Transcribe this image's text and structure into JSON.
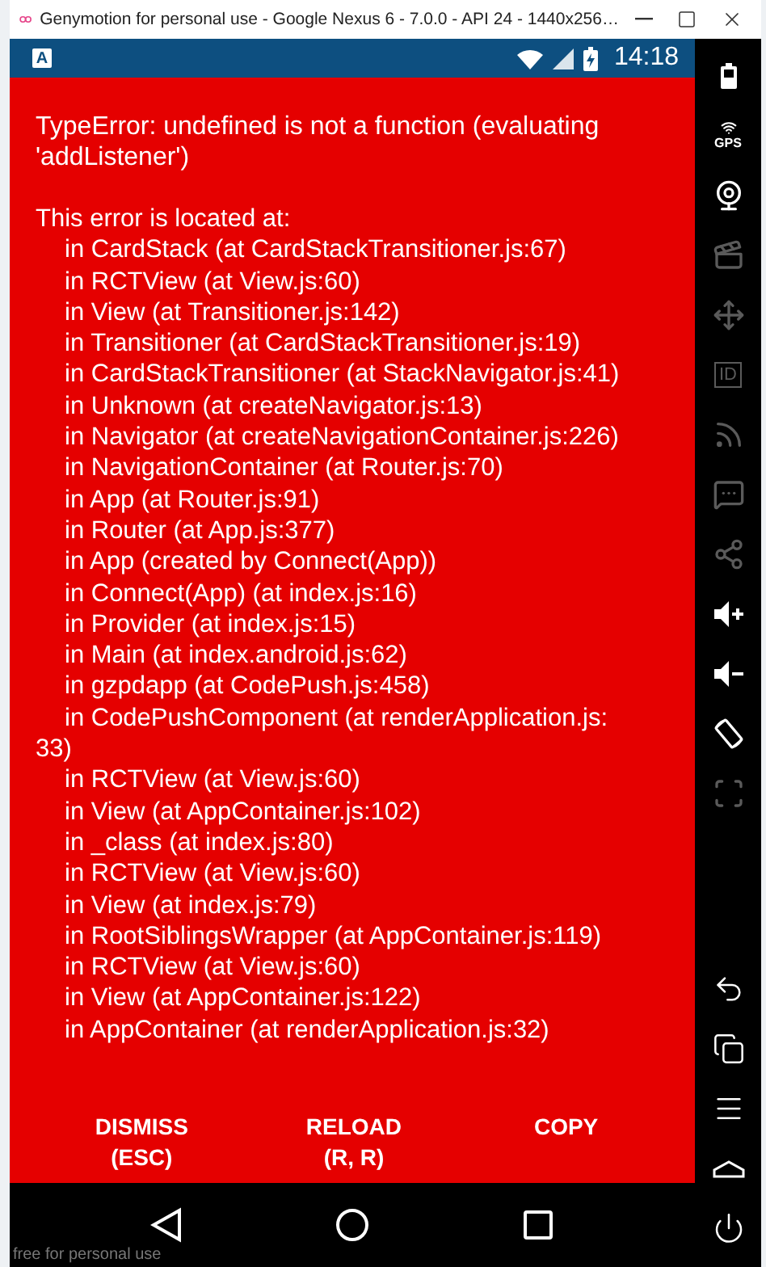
{
  "window": {
    "title": "Genymotion for personal use - Google Nexus 6 - 7.0.0 - API 24 - 1440x256…"
  },
  "status_bar": {
    "notification": "A",
    "time": "14:18"
  },
  "error": {
    "message": "TypeError: undefined is not a function (evaluating 'addListener')",
    "location_heading": "This error is located at:",
    "stack": [
      {
        "kind": "frame",
        "text": "in CardStack (at CardStackTransitioner.js:67)"
      },
      {
        "kind": "frame",
        "text": "in RCTView (at View.js:60)"
      },
      {
        "kind": "frame",
        "text": "in View (at Transitioner.js:142)"
      },
      {
        "kind": "frame",
        "text": "in Transitioner (at CardStackTransitioner.js:19)"
      },
      {
        "kind": "frame",
        "text": "in CardStackTransitioner (at StackNavigator.js:41)"
      },
      {
        "kind": "frame",
        "text": "in Unknown (at createNavigator.js:13)"
      },
      {
        "kind": "frame",
        "text": "in Navigator (at createNavigationContainer.js:226)"
      },
      {
        "kind": "frame",
        "text": "in NavigationContainer (at Router.js:70)"
      },
      {
        "kind": "frame",
        "text": "in App (at Router.js:91)"
      },
      {
        "kind": "frame",
        "text": "in Router (at App.js:377)"
      },
      {
        "kind": "frame",
        "text": "in App (created by Connect(App))"
      },
      {
        "kind": "frame",
        "text": "in Connect(App) (at index.js:16)"
      },
      {
        "kind": "frame",
        "text": "in Provider (at index.js:15)"
      },
      {
        "kind": "frame",
        "text": "in Main (at index.android.js:62)"
      },
      {
        "kind": "frame",
        "text": "in gzpdapp (at CodePush.js:458)"
      },
      {
        "kind": "frame",
        "text": "in CodePushComponent (at renderApplication.js:"
      },
      {
        "kind": "continuation",
        "text": "33)"
      },
      {
        "kind": "frame",
        "text": "in RCTView (at View.js:60)"
      },
      {
        "kind": "frame",
        "text": "in View (at AppContainer.js:102)"
      },
      {
        "kind": "frame",
        "text": "in _class (at index.js:80)"
      },
      {
        "kind": "frame",
        "text": "in RCTView (at View.js:60)"
      },
      {
        "kind": "frame",
        "text": "in View (at index.js:79)"
      },
      {
        "kind": "frame",
        "text": "in RootSiblingsWrapper (at AppContainer.js:119)"
      },
      {
        "kind": "frame",
        "text": "in RCTView (at View.js:60)"
      },
      {
        "kind": "frame",
        "text": "in View (at AppContainer.js:122)"
      },
      {
        "kind": "frame",
        "text": "in AppContainer (at renderApplication.js:32)"
      }
    ]
  },
  "buttons": [
    {
      "label": "DISMISS",
      "shortcut": "(ESC)"
    },
    {
      "label": "RELOAD",
      "shortcut": "(R, R)"
    },
    {
      "label": "COPY"
    }
  ],
  "toolbar": [
    {
      "kind": "battery"
    },
    {
      "kind": "gps",
      "label": "GPS",
      "disabled": false
    },
    {
      "kind": "webcam",
      "disabled": false
    },
    {
      "kind": "capture",
      "disabled": true
    },
    {
      "kind": "dpad",
      "disabled": true
    },
    {
      "kind": "id",
      "label": "ID",
      "disabled": true
    },
    {
      "kind": "network",
      "disabled": true
    },
    {
      "kind": "messages",
      "disabled": true
    },
    {
      "kind": "share",
      "disabled": true
    },
    {
      "kind": "volume_up",
      "disabled": false
    },
    {
      "kind": "volume_down",
      "disabled": false
    },
    {
      "kind": "rotate",
      "disabled": false
    },
    {
      "kind": "pixel",
      "disabled": true
    },
    {
      "kind": "spacer"
    },
    {
      "kind": "back",
      "disabled": false
    },
    {
      "kind": "recents",
      "disabled": false
    },
    {
      "kind": "menu",
      "disabled": false
    },
    {
      "kind": "home",
      "disabled": false
    },
    {
      "kind": "power",
      "disabled": false
    }
  ],
  "footer": {
    "notice": "free for personal use"
  }
}
